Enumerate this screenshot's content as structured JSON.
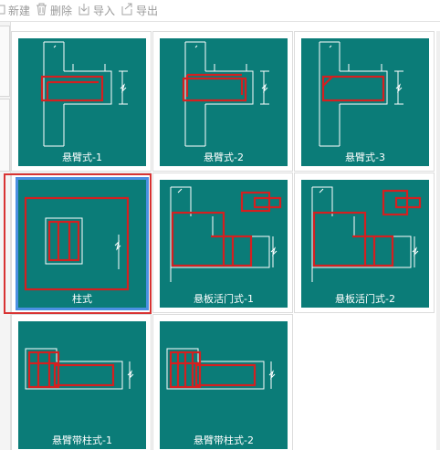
{
  "toolbar": {
    "new_label": "新建",
    "delete_label": "删除",
    "import_label": "导入",
    "export_label": "导出"
  },
  "colors": {
    "tile_bg": "#0b7c78",
    "line_white": "#ffffff",
    "rebar_red": "#d42020",
    "selection_blue": "#4a90e2",
    "annotation_red": "#d83333"
  },
  "types": [
    {
      "label": "悬臂式-1",
      "icon": "cantilever-type-1-diagram",
      "selected": false
    },
    {
      "label": "悬臂式-2",
      "icon": "cantilever-type-2-diagram",
      "selected": false
    },
    {
      "label": "悬臂式-3",
      "icon": "cantilever-type-3-diagram",
      "selected": false
    },
    {
      "label": "柱式",
      "icon": "column-type-diagram",
      "selected": true
    },
    {
      "label": "悬板活门式-1",
      "icon": "hanging-slab-door-type-1-diagram",
      "selected": false
    },
    {
      "label": "悬板活门式-2",
      "icon": "hanging-slab-door-type-2-diagram",
      "selected": false
    },
    {
      "label": "悬臂带柱式-1",
      "icon": "cantilever-with-column-type-1-diagram",
      "selected": false
    },
    {
      "label": "悬臂带柱式-2",
      "icon": "cantilever-with-column-type-2-diagram",
      "selected": false
    }
  ]
}
